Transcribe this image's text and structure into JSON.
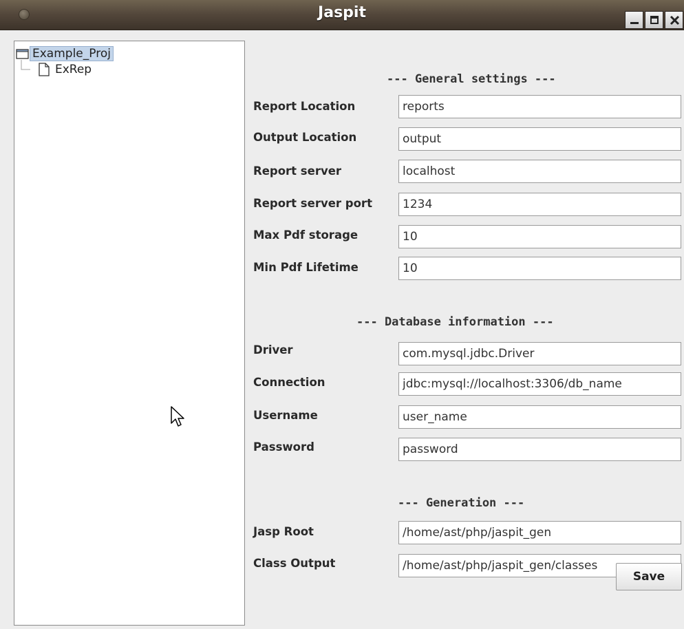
{
  "window": {
    "title": "Jaspit"
  },
  "tree": {
    "root": {
      "label": "Example_Proj",
      "icon": "folder-icon"
    },
    "children": [
      {
        "label": "ExRep",
        "icon": "file-icon"
      }
    ]
  },
  "general": {
    "heading": "--- General settings ---",
    "fields": [
      {
        "label": "Report Location",
        "value": "reports"
      },
      {
        "label": "Output Location",
        "value": "output"
      },
      {
        "label": "Report server",
        "value": "localhost"
      },
      {
        "label": "Report server port",
        "value": "1234"
      },
      {
        "label": "Max Pdf storage",
        "value": "10"
      },
      {
        "label": "Min Pdf Lifetime",
        "value": "10"
      }
    ]
  },
  "database": {
    "heading": "--- Database information ---",
    "fields": [
      {
        "label": "Driver",
        "value": "com.mysql.jdbc.Driver"
      },
      {
        "label": "Connection",
        "value": "jdbc:mysql://localhost:3306/db_name"
      },
      {
        "label": "Username",
        "value": "user_name"
      },
      {
        "label": "Password",
        "value": "password"
      }
    ]
  },
  "generation": {
    "heading": "--- Generation ---",
    "fields": [
      {
        "label": "Jasp Root",
        "value": "/home/ast/php/jaspit_gen"
      },
      {
        "label": "Class Output",
        "value": "/home/ast/php/jaspit_gen/classes"
      }
    ]
  },
  "buttons": {
    "save": "Save"
  }
}
